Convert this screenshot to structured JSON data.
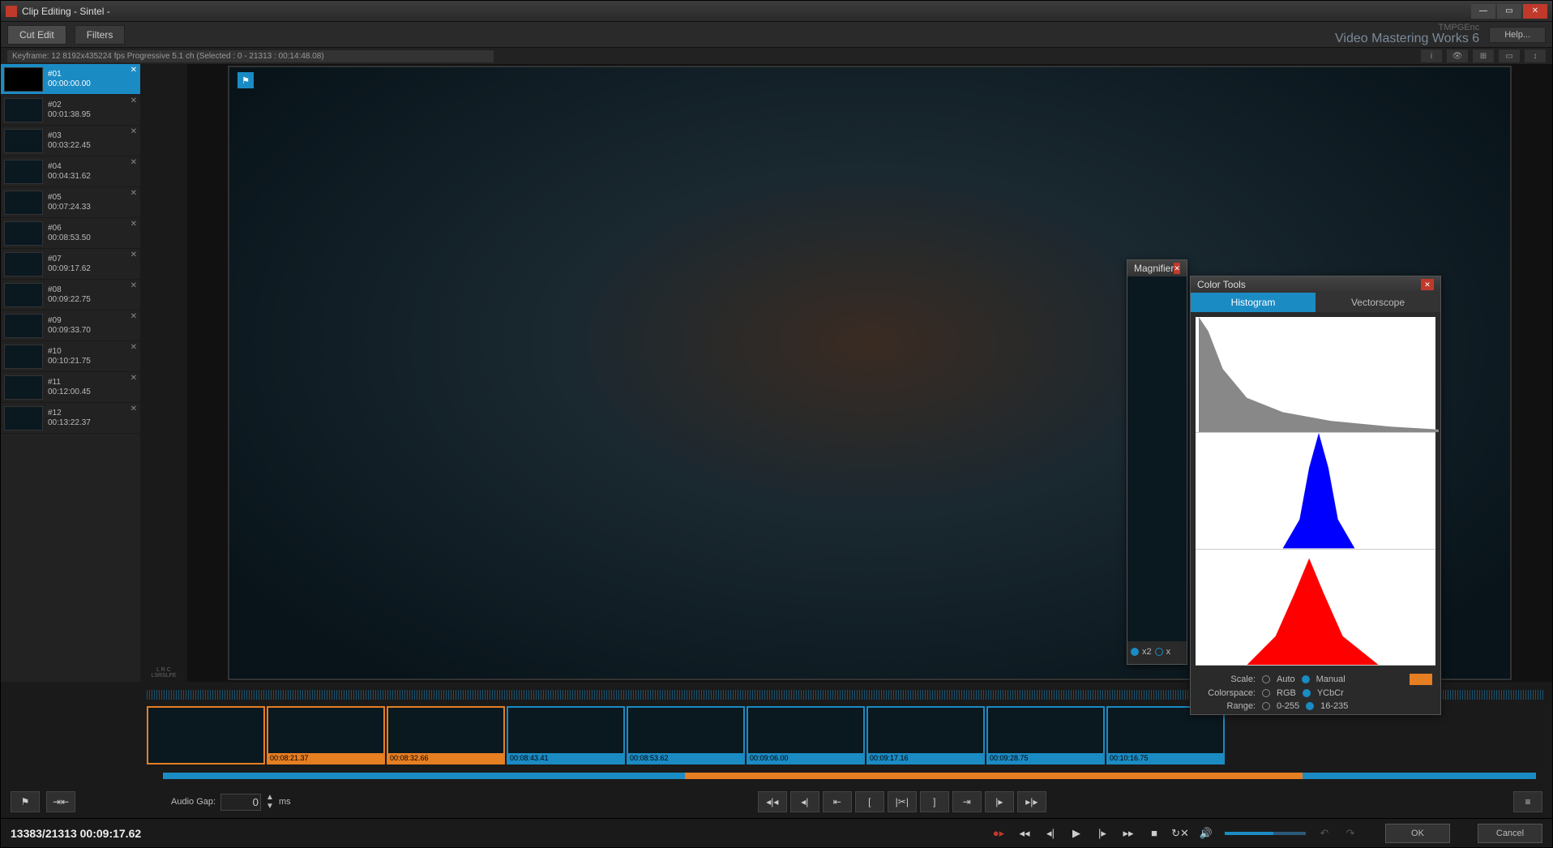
{
  "titlebar": {
    "title": "Clip Editing - Sintel -"
  },
  "toolbar": {
    "cut_edit": "Cut Edit",
    "filters": "Filters",
    "help": "Help...",
    "brand_small": "TMPGEnc",
    "brand_big": "Video Mastering Works 6"
  },
  "infobar": {
    "text": "Keyframe: 12 8192x435224 fps  Progressive  5.1 ch  (Selected : 0 - 21313 : 00:14:48.08)"
  },
  "clips": [
    {
      "num": "#01",
      "tc": "00:00:00.00",
      "active": true
    },
    {
      "num": "#02",
      "tc": "00:01:38.95"
    },
    {
      "num": "#03",
      "tc": "00:03:22.45"
    },
    {
      "num": "#04",
      "tc": "00:04:31.62"
    },
    {
      "num": "#05",
      "tc": "00:07:24.33"
    },
    {
      "num": "#06",
      "tc": "00:08:53.50"
    },
    {
      "num": "#07",
      "tc": "00:09:17.62"
    },
    {
      "num": "#08",
      "tc": "00:09:22.75"
    },
    {
      "num": "#09",
      "tc": "00:09:33.70"
    },
    {
      "num": "#10",
      "tc": "00:10:21.75"
    },
    {
      "num": "#11",
      "tc": "00:12:00.45"
    },
    {
      "num": "#12",
      "tc": "00:13:22.37"
    }
  ],
  "channels_label": "L R C LSRSLFE",
  "timeline_thumbs": [
    {
      "tc": "",
      "color": "orange"
    },
    {
      "tc": "00:08:21.37",
      "color": "orange"
    },
    {
      "tc": "00:08:32.66",
      "color": "orange"
    },
    {
      "tc": "00:08:43.41",
      "color": "blue"
    },
    {
      "tc": "00:08:53.62",
      "color": "blue"
    },
    {
      "tc": "00:09:06.00",
      "color": "blue"
    },
    {
      "tc": "00:09:17.16",
      "color": "blue"
    },
    {
      "tc": "00:09:28.75",
      "color": "blue"
    },
    {
      "tc": "00:10:16.75",
      "color": "blue"
    }
  ],
  "audio_gap": {
    "label": "Audio Gap:",
    "value": "0",
    "unit": "ms"
  },
  "status": {
    "position": "13383/21313  00:09:17.62"
  },
  "buttons": {
    "ok": "OK",
    "cancel": "Cancel"
  },
  "magnifier": {
    "title": "Magnifier",
    "zoom_in": "x2",
    "zoom_out": "x"
  },
  "colortools": {
    "title": "Color Tools",
    "tabs": {
      "histogram": "Histogram",
      "vectorscope": "Vectorscope"
    },
    "scale": {
      "label": "Scale:",
      "auto": "Auto",
      "manual": "Manual"
    },
    "colorspace": {
      "label": "Colorspace:",
      "rgb": "RGB",
      "ycbcr": "YCbCr"
    },
    "range": {
      "label": "Range:",
      "r0": "0-255",
      "r16": "16-235"
    }
  }
}
